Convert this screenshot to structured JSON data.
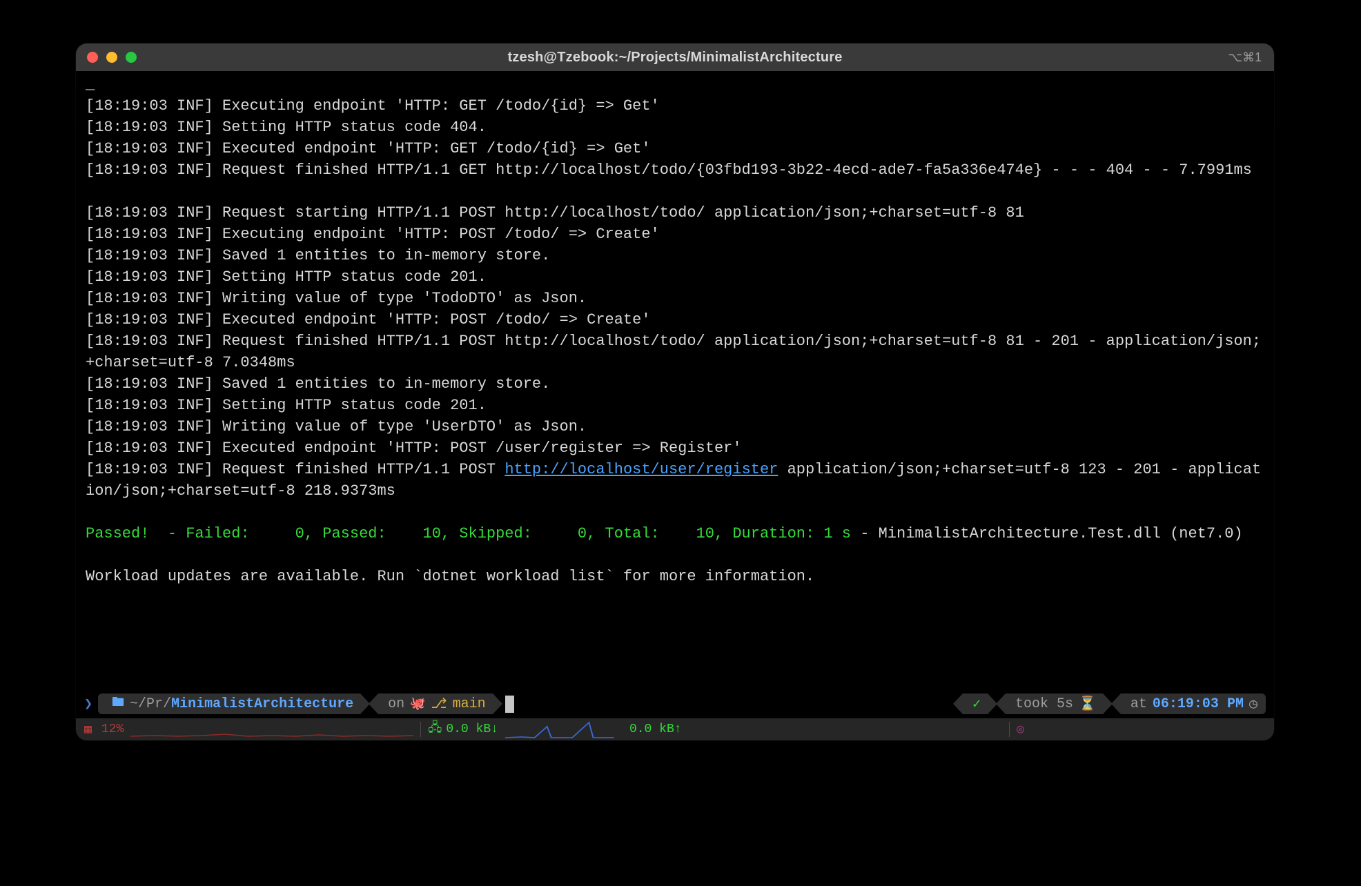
{
  "window": {
    "title": "tzesh@Tzebook:~/Projects/MinimalistArchitecture",
    "shortcut": "⌥⌘1"
  },
  "log": {
    "lines": [
      {
        "t": "text",
        "v": "_"
      },
      {
        "t": "text",
        "v": "[18:19:03 INF] Executing endpoint 'HTTP: GET /todo/{id} => Get'"
      },
      {
        "t": "text",
        "v": "[18:19:03 INF] Setting HTTP status code 404."
      },
      {
        "t": "text",
        "v": "[18:19:03 INF] Executed endpoint 'HTTP: GET /todo/{id} => Get'"
      },
      {
        "t": "text",
        "v": "[18:19:03 INF] Request finished HTTP/1.1 GET http://localhost/todo/{03fbd193-3b22-4ecd-ade7-fa5a336e474e} - - - 404 - - 7.7991ms"
      },
      {
        "t": "blank"
      },
      {
        "t": "text",
        "v": "[18:19:03 INF] Request starting HTTP/1.1 POST http://localhost/todo/ application/json;+charset=utf-8 81"
      },
      {
        "t": "text",
        "v": "[18:19:03 INF] Executing endpoint 'HTTP: POST /todo/ => Create'"
      },
      {
        "t": "text",
        "v": "[18:19:03 INF] Saved 1 entities to in-memory store."
      },
      {
        "t": "text",
        "v": "[18:19:03 INF] Setting HTTP status code 201."
      },
      {
        "t": "text",
        "v": "[18:19:03 INF] Writing value of type 'TodoDTO' as Json."
      },
      {
        "t": "text",
        "v": "[18:19:03 INF] Executed endpoint 'HTTP: POST /todo/ => Create'"
      },
      {
        "t": "text",
        "v": "[18:19:03 INF] Request finished HTTP/1.1 POST http://localhost/todo/ application/json;+charset=utf-8 81 - 201 - application/json;+charset=utf-8 7.0348ms"
      },
      {
        "t": "text",
        "v": "[18:19:03 INF] Saved 1 entities to in-memory store."
      },
      {
        "t": "text",
        "v": "[18:19:03 INF] Setting HTTP status code 201."
      },
      {
        "t": "text",
        "v": "[18:19:03 INF] Writing value of type 'UserDTO' as Json."
      },
      {
        "t": "text",
        "v": "[18:19:03 INF] Executed endpoint 'HTTP: POST /user/register => Register'"
      },
      {
        "t": "linked",
        "prefix": "[18:19:03 INF] Request finished HTTP/1.1 POST ",
        "link": "http://localhost/user/register",
        "suffix": " application/json;+charset=utf-8 123 - 201 - application/json;+charset=utf-8 218.9373ms"
      },
      {
        "t": "blank"
      },
      {
        "t": "result",
        "passed": "Passed!",
        "details": "  - Failed:     0, Passed:    10, Skipped:     0, Total:    10, Duration: 1 s",
        "tail": " - MinimalistArchitecture.Test.dll (net7.0)"
      },
      {
        "t": "blank"
      },
      {
        "t": "text",
        "v": "Workload updates are available. Run `dotnet workload list` for more information."
      }
    ]
  },
  "prompt": {
    "path_prefix": "~/Pr/",
    "path_highlight": "MinimalistArchitecture",
    "on": "on",
    "branch": "main",
    "status_ok": "✓",
    "took": "took 5s",
    "at": "at",
    "time": "06:19:03 PM"
  },
  "stats": {
    "cpu_pct": "12%",
    "net_down": "0.0 kB↓",
    "net_up": "0.0 kB↑"
  }
}
